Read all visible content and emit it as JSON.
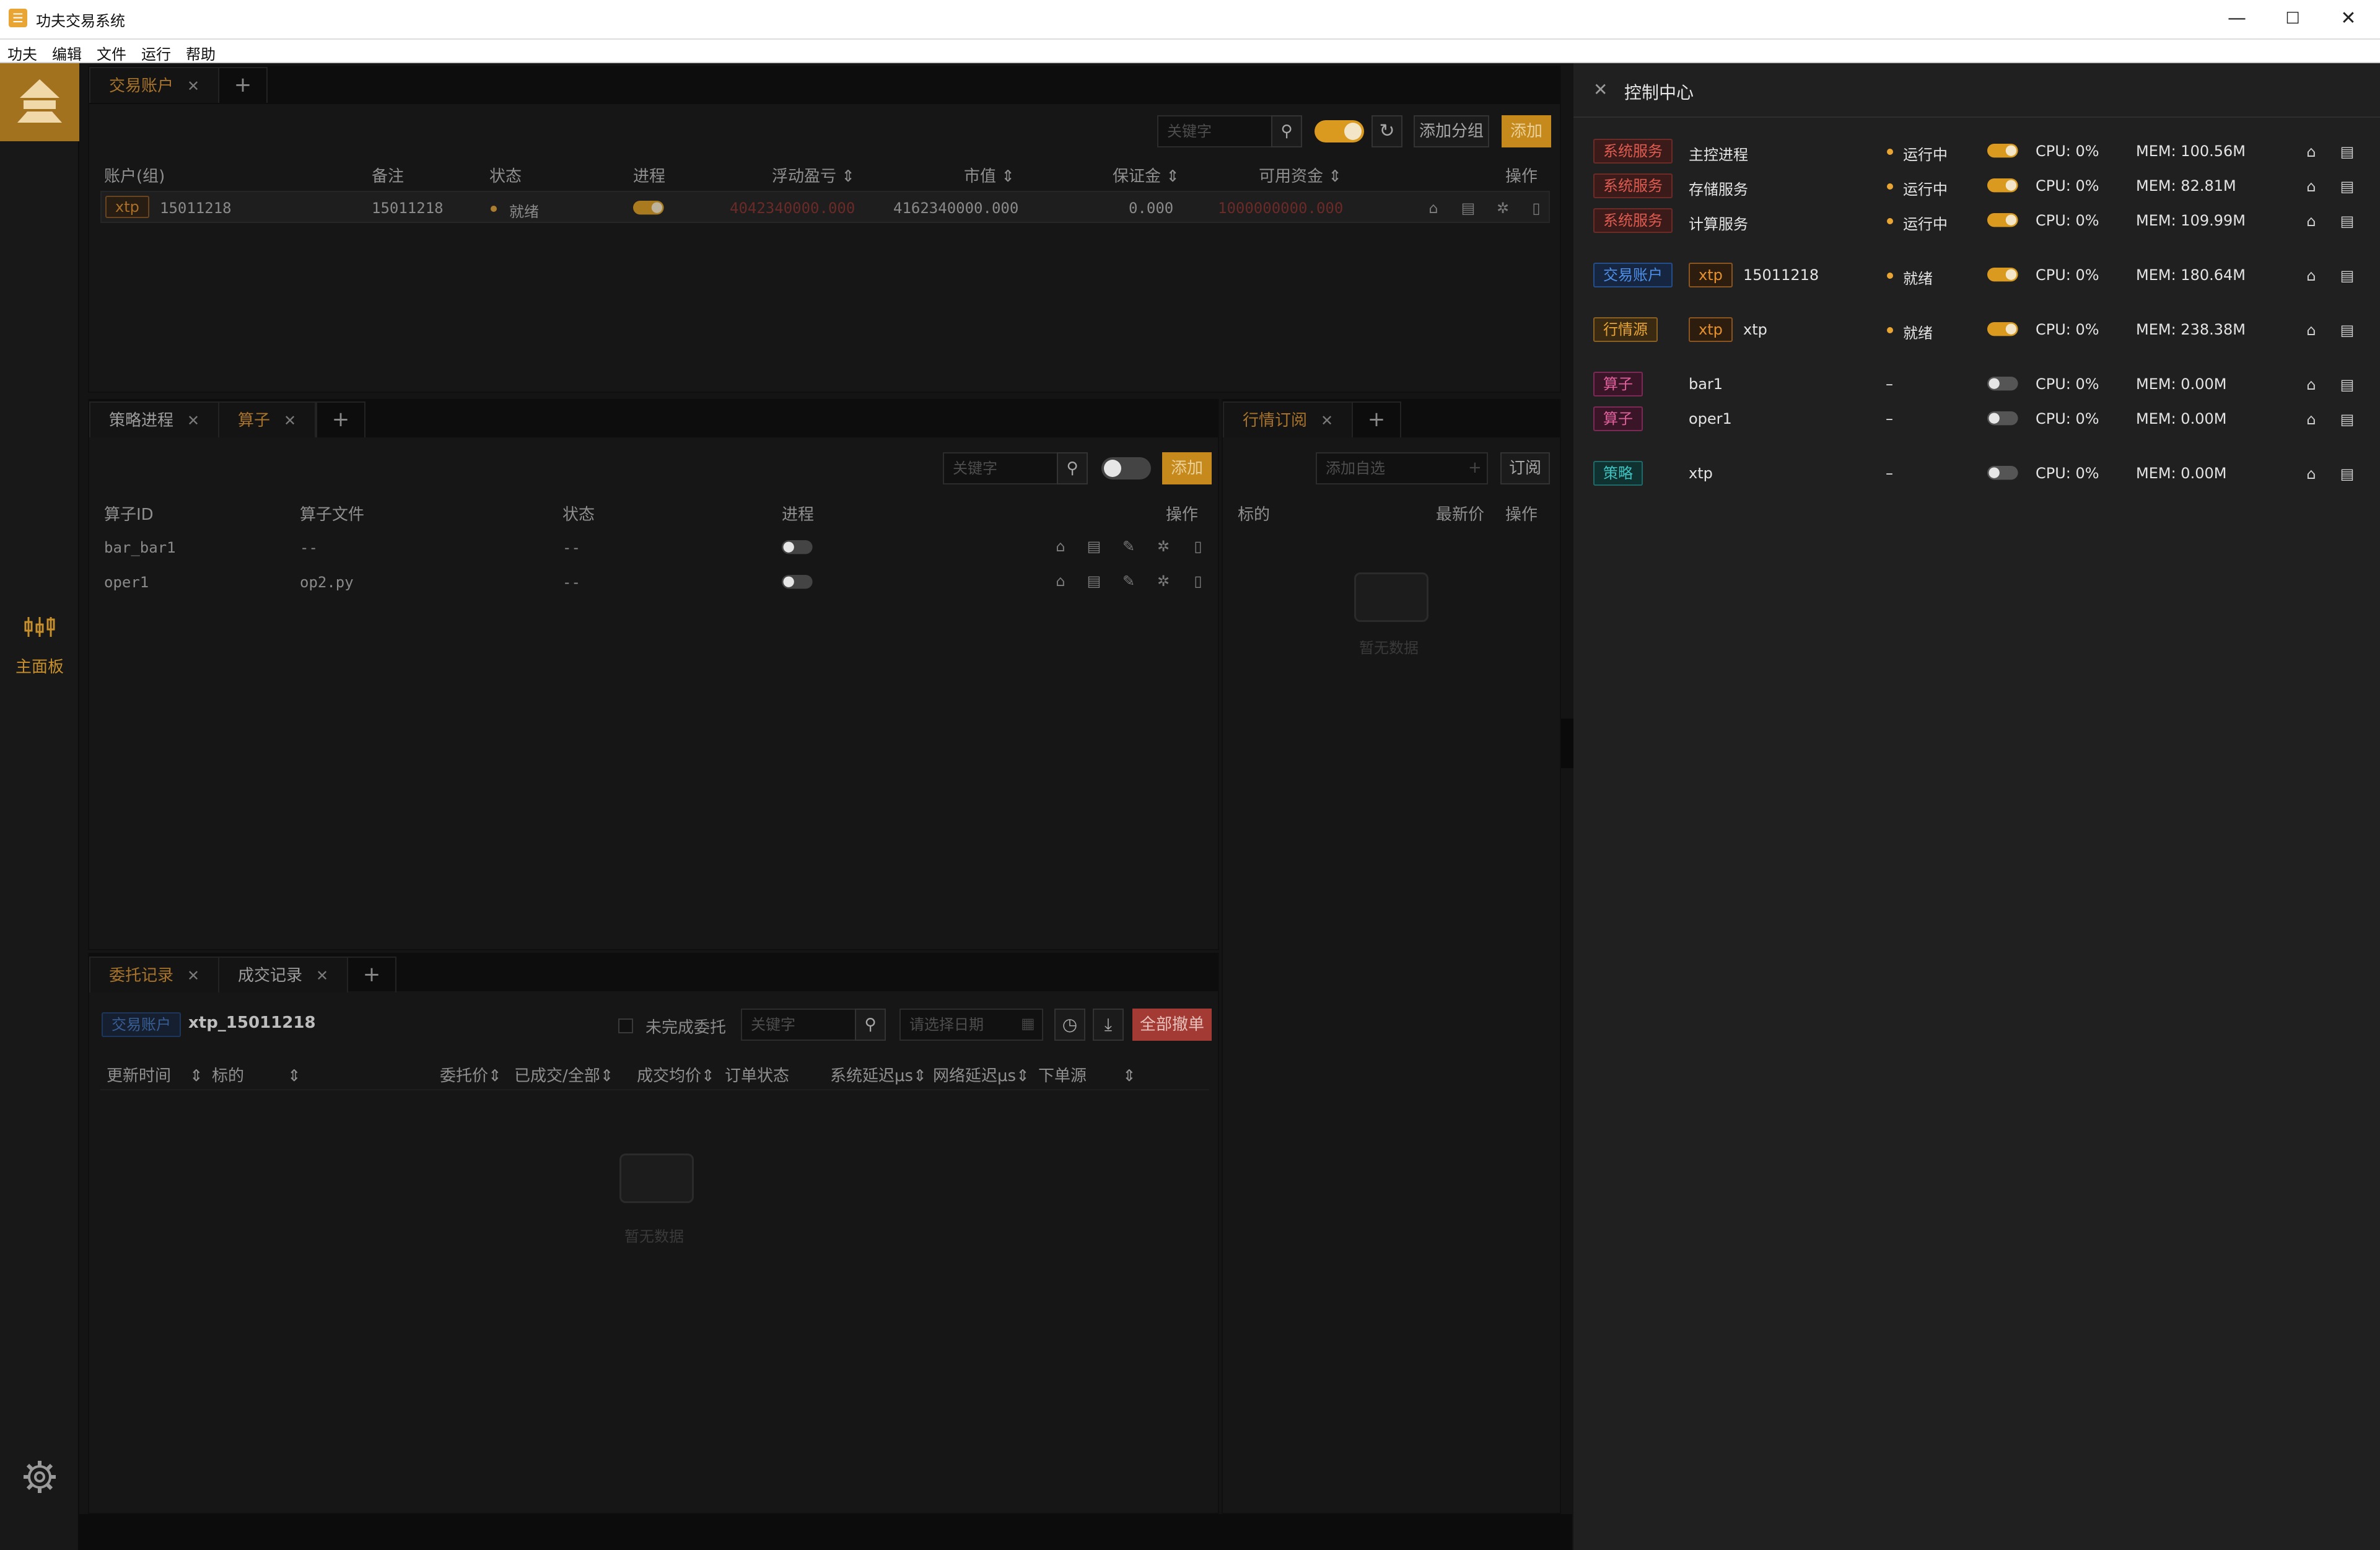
{
  "window": {
    "title": "功夫交易系统",
    "minimize": "—",
    "maximize": "☐",
    "close": "✕"
  },
  "menu": [
    "功夫",
    "编辑",
    "文件",
    "运行",
    "帮助"
  ],
  "sidebar": {
    "nav_label": "主面板"
  },
  "accounts_panel": {
    "tabs": [
      {
        "label": "交易账户"
      }
    ],
    "search_placeholder": "关键字",
    "add_group_label": "添加分组",
    "add_label": "添加",
    "columns": [
      "账户(组)",
      "备注",
      "状态",
      "进程",
      "浮动盈亏",
      "市值",
      "保证金",
      "可用资金",
      "操作"
    ],
    "rows": [
      {
        "tag": "xtp",
        "account": "15011218",
        "note": "15011218",
        "status": "就绪",
        "process_on": true,
        "pnl": "4042340000.000",
        "market_value": "4162340000.000",
        "margin": "0.000",
        "available": "1000000000.000"
      }
    ]
  },
  "strategy_panel": {
    "tabs": [
      {
        "label": "策略进程"
      },
      {
        "label": "算子"
      }
    ],
    "search_placeholder": "关键字",
    "add_label": "添加",
    "columns": [
      "算子ID",
      "算子文件",
      "状态",
      "进程",
      "操作"
    ],
    "rows": [
      {
        "id": "bar_bar1",
        "file": "--",
        "status": "--",
        "process_on": false
      },
      {
        "id": "oper1",
        "file": "op2.py",
        "status": "--",
        "process_on": false
      }
    ]
  },
  "market_panel": {
    "tabs": [
      {
        "label": "行情订阅"
      }
    ],
    "add_placeholder": "添加自选",
    "subscribe_label": "订阅",
    "columns": [
      "标的",
      "最新价",
      "操作"
    ],
    "empty_text": "暂无数据"
  },
  "orders_panel": {
    "tabs": [
      {
        "label": "委托记录"
      },
      {
        "label": "成交记录"
      }
    ],
    "account_tag": "交易账户",
    "account_name": "xtp_15011218",
    "unfinished_label": "未完成委托",
    "search_placeholder": "关键字",
    "date_placeholder": "请选择日期",
    "cancel_all_label": "全部撤单",
    "columns": [
      "更新时间",
      "标的",
      "委托价",
      "已成交/全部",
      "成交均价",
      "订单状态",
      "系统延迟μs",
      "网络延迟μs",
      "下单源"
    ],
    "empty_text": "暂无数据"
  },
  "control_center": {
    "title": "控制中心",
    "rows": [
      {
        "tag": "系统服务",
        "tag_type": "sys",
        "name": "主控进程",
        "status": "运行中",
        "on": true,
        "cpu": "CPU: 0%",
        "mem": "MEM: 100.56M"
      },
      {
        "tag": "系统服务",
        "tag_type": "sys",
        "name": "存储服务",
        "status": "运行中",
        "on": true,
        "cpu": "CPU: 0%",
        "mem": "MEM: 82.81M"
      },
      {
        "tag": "系统服务",
        "tag_type": "sys",
        "name": "计算服务",
        "status": "运行中",
        "on": true,
        "cpu": "CPU: 0%",
        "mem": "MEM: 109.99M"
      },
      {
        "tag": "交易账户",
        "tag_type": "acc",
        "sub_tag": "xtp",
        "name": "15011218",
        "status": "就绪",
        "on": true,
        "cpu": "CPU: 0%",
        "mem": "MEM: 180.64M"
      },
      {
        "tag": "行情源",
        "tag_type": "md",
        "sub_tag": "xtp",
        "name": "xtp",
        "status": "就绪",
        "on": true,
        "cpu": "CPU: 0%",
        "mem": "MEM: 238.38M"
      },
      {
        "tag": "算子",
        "tag_type": "calc",
        "name": "bar1",
        "status": "–",
        "on": false,
        "cpu": "CPU: 0%",
        "mem": "MEM: 0.00M"
      },
      {
        "tag": "算子",
        "tag_type": "calc",
        "name": "oper1",
        "status": "–",
        "on": false,
        "cpu": "CPU: 0%",
        "mem": "MEM: 0.00M"
      },
      {
        "tag": "策略",
        "tag_type": "strat",
        "name": "xtp",
        "status": "–",
        "on": false,
        "cpu": "CPU: 0%",
        "mem": "MEM: 0.00M"
      }
    ]
  }
}
